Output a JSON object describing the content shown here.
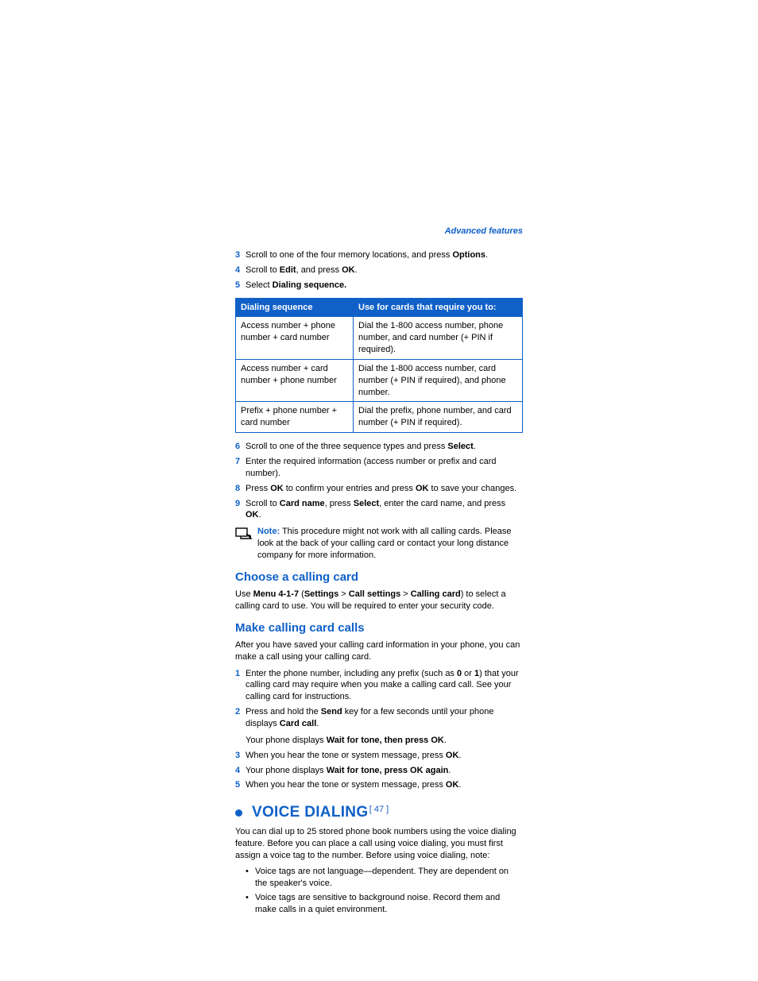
{
  "header": {
    "section": "Advanced features"
  },
  "stepsA": [
    {
      "n": "3",
      "pre": "Scroll to one of the four memory locations, and press ",
      "b": "Options",
      "post": "."
    },
    {
      "n": "4",
      "pre": "Scroll to ",
      "b": "Edit",
      "mid": ", and press ",
      "b2": "OK",
      "post": "."
    },
    {
      "n": "5",
      "pre": "Select ",
      "b": "Dialing sequence.",
      "post": ""
    }
  ],
  "table": {
    "h1": "Dialing sequence",
    "h2": "Use for cards that require you to:",
    "rows": [
      {
        "c1": "Access number + phone number + card number",
        "c2": "Dial the 1-800 access number, phone number, and card number (+ PIN if required)."
      },
      {
        "c1": "Access number + card number + phone number",
        "c2": "Dial the 1-800 access number, card number (+ PIN if required), and phone number."
      },
      {
        "c1": "Prefix + phone number + card number",
        "c2": "Dial the prefix, phone number, and card number (+ PIN if required)."
      }
    ]
  },
  "stepsB": [
    {
      "n": "6",
      "html": "Scroll to one of the three sequence types and press <b>Select</b>."
    },
    {
      "n": "7",
      "html": "Enter the required information (access number or prefix and card number)."
    },
    {
      "n": "8",
      "html": "Press <b>OK</b> to confirm your entries and press <b>OK</b> to save your changes."
    },
    {
      "n": "9",
      "html": "Scroll to <b>Card name</b>, press <b>Select</b>, enter the card name, and press <b>OK</b>."
    }
  ],
  "note": {
    "label": "Note:",
    "text": " This procedure might not work with all calling cards. Please look at the back of your calling card or contact your long distance company for more information."
  },
  "choose": {
    "title": "Choose a calling card",
    "html": "Use <b>Menu 4-1-7</b> (<b>Settings</b> > <b>Call settings</b> > <b>Calling card</b>) to select a calling card to use. You will be required to enter your security code."
  },
  "make": {
    "title": "Make calling card calls",
    "intro": "After you have saved your calling card information in your phone, you can make a call using your calling card.",
    "steps": [
      {
        "n": "1",
        "html": "Enter the phone number, including any prefix (such as <b>0</b> or <b>1</b>) that your calling card may require when you make a calling card call. See your calling card for instructions."
      },
      {
        "n": "2",
        "html": "Press and hold the <b>Send</b> key for a few seconds until your phone displays <b>Card call</b>.",
        "sub": "Your phone displays <b>Wait for tone, then press OK</b>."
      },
      {
        "n": "3",
        "html": "When you hear the tone or system message, press <b>OK</b>."
      },
      {
        "n": "4",
        "html": "Your phone displays <b>Wait for tone, press OK again</b>."
      },
      {
        "n": "5",
        "html": "When you hear the tone or system message, press <b>OK</b>."
      }
    ]
  },
  "voice": {
    "title": "VOICE DIALING",
    "intro": "You can dial up to 25 stored phone book numbers using the voice dialing feature. Before you can place a call using voice dialing, you must first assign a voice tag to the number. Before using voice dialing, note:",
    "bullets": [
      "Voice tags are not language—dependent. They are dependent on the speaker's voice.",
      "Voice tags are sensitive to background noise. Record them and make calls in a quiet environment."
    ]
  },
  "footer": {
    "page": "[ 47 ]"
  }
}
